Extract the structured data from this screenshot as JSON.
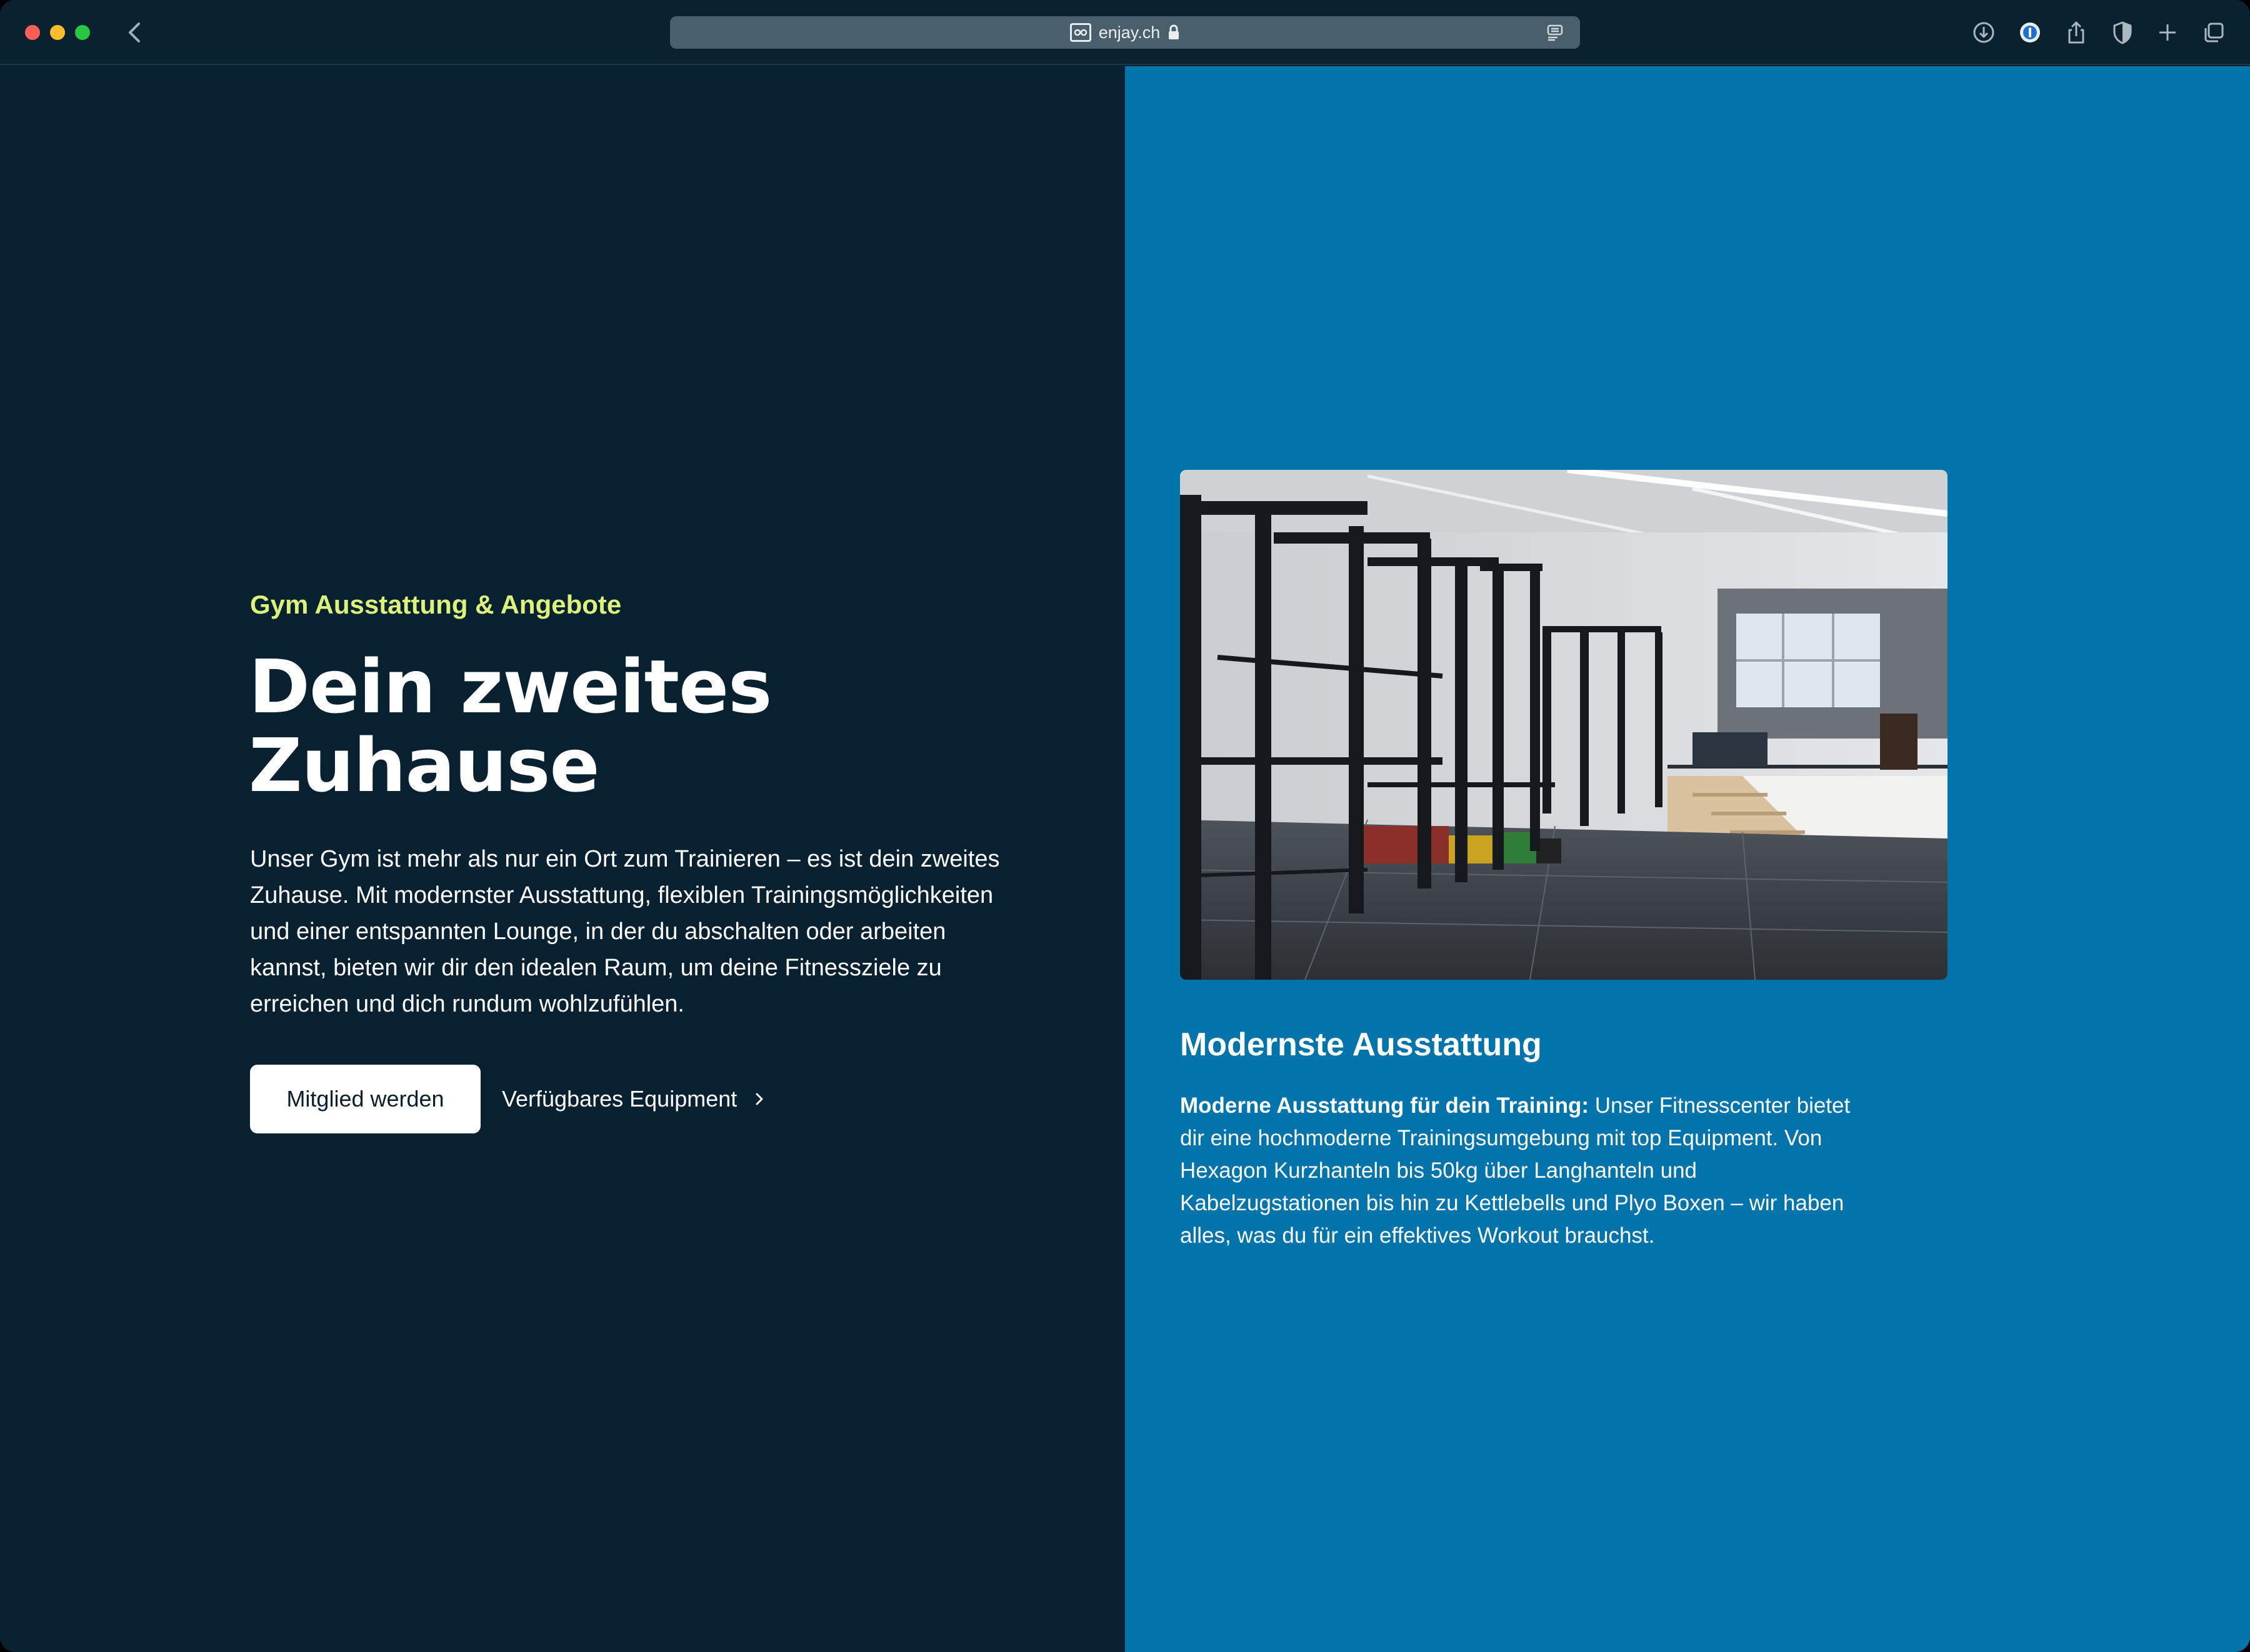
{
  "browser": {
    "url": "enjay.ch"
  },
  "hero": {
    "eyebrow": "Gym Ausstattung & Angebote",
    "headline_line1": "Dein zweites",
    "headline_line2": "Zuhause",
    "body": "Unser Gym ist mehr als nur ein Ort zum Trainieren – es ist dein zweites Zuhause. Mit modernster Ausstattung, flexiblen Trainingsmöglichkeiten und einer entspannten Lounge, in der du abschalten oder arbeiten kannst, bieten wir dir den idealen Raum, um deine Fitnessziele zu erreichen und dich rundum wohlzufühlen.",
    "primary_button": "Mitglied werden",
    "secondary_link": "Verfügbares Equipment"
  },
  "feature": {
    "title": "Modernste Ausstattung",
    "lead": "Moderne Ausstattung für dein Training:",
    "text": " Unser Fitnesscenter bietet dir eine hochmoderne Trainingsumgebung mit top Equipment. Von Hexagon Kurzhanteln bis 50kg über Langhanteln und Kabelzugstationen bis hin zu Kettlebells und Plyo Boxen – wir haben alles, was du für ein effektives Workout brauchst."
  },
  "colors": {
    "left_background": "#072130",
    "right_background": "#0074ab",
    "eyebrow_accent": "#dcf27a"
  },
  "icons": {
    "toolbar": [
      "download-icon",
      "password-icon",
      "share-icon",
      "privacy-shield-icon",
      "new-tab-icon",
      "tab-overview-icon"
    ]
  }
}
